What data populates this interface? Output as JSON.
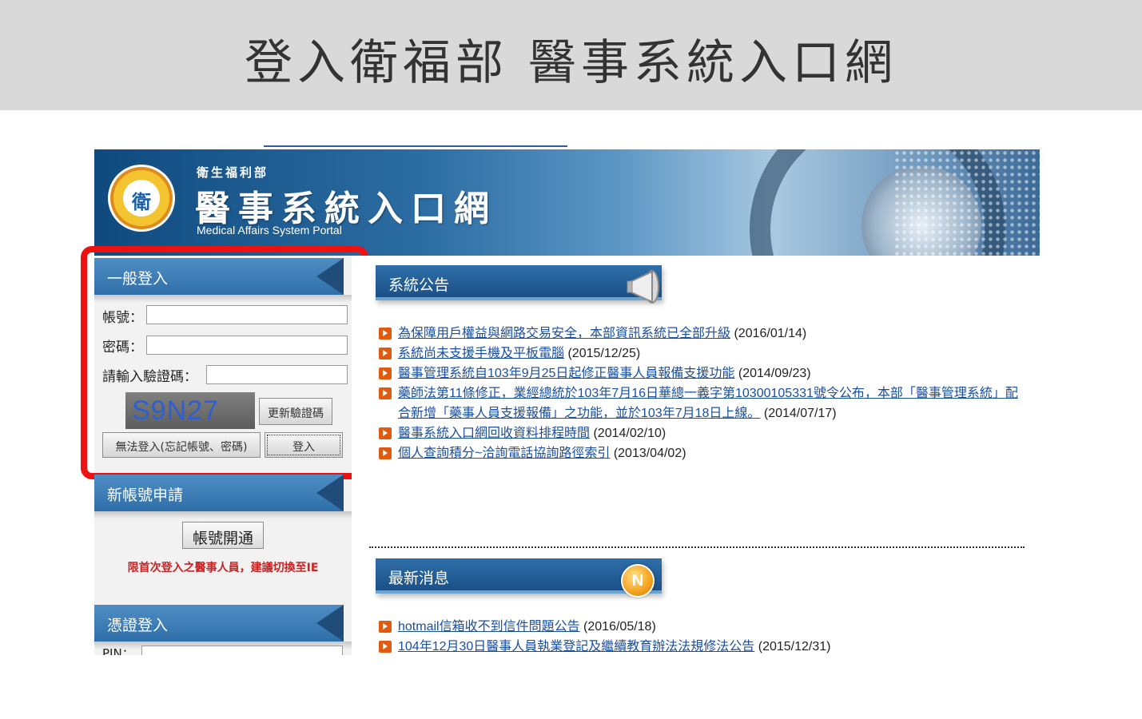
{
  "slide": {
    "title": "登入衛福部  醫事系統入口網"
  },
  "banner": {
    "org_name": "衛生福利部",
    "portal_title": "醫事系統入口網",
    "portal_en": "Medical Affairs System Portal",
    "logo_mark": "衛"
  },
  "login": {
    "header": "一般登入",
    "account_label": "帳號：",
    "account_value": "",
    "password_label": "密碼：",
    "password_value": "",
    "captcha_label": "請輸入驗證碼：",
    "captcha_value": "",
    "captcha_text": "S9N27",
    "refresh_captcha_button": "更新驗證碼",
    "forgot_button": "無法登入(忘記帳號、密碼)",
    "login_button": "登入"
  },
  "new_account": {
    "header": "新帳號申請",
    "open_button": "帳號開通",
    "notice": "限首次登入之醫事人員，建議切換至IE"
  },
  "cert_login": {
    "header": "憑證登入",
    "pin_label": "PIN："
  },
  "announcements": {
    "header": "系統公告",
    "items": [
      {
        "title": "為保障用戶權益與網路交易安全，本部資訊系統已全部升級",
        "date": "(2016/01/14)"
      },
      {
        "title": "系統尚未支援手機及平板電腦",
        "date": "(2015/12/25)"
      },
      {
        "title": "醫事管理系統自103年9月25日起修正醫事人員報備支援功能",
        "date": "(2014/09/23)"
      },
      {
        "title": "藥師法第11條修正，業經總統於103年7月16日華總一義字第10300105331號令公布，本部「醫事管理系統」配合新增「藥事人員支援報備」之功能，並於103年7月18日上線。",
        "date": "(2014/07/17)"
      },
      {
        "title": "醫事系統入口網回收資料排程時間",
        "date": "(2014/02/10)"
      },
      {
        "title": "個人查詢積分~洽詢電話協詢路徑索引",
        "date": "(2013/04/02)"
      }
    ]
  },
  "latest_news": {
    "header": "最新消息",
    "badge": "N",
    "items": [
      {
        "title": "hotmail信箱收不到信件問題公告",
        "date": "(2016/05/18)"
      },
      {
        "title": "104年12月30日醫事人員執業登記及繼續教育辦法法規修法公告",
        "date": "(2015/12/31)"
      }
    ]
  },
  "colors": {
    "panel_blue": "#2f6fa9",
    "highlight_red": "#ee1111",
    "link_blue": "#1a4fa0",
    "warn_red": "#cc2222",
    "bullet_orange": "#e05a10"
  }
}
